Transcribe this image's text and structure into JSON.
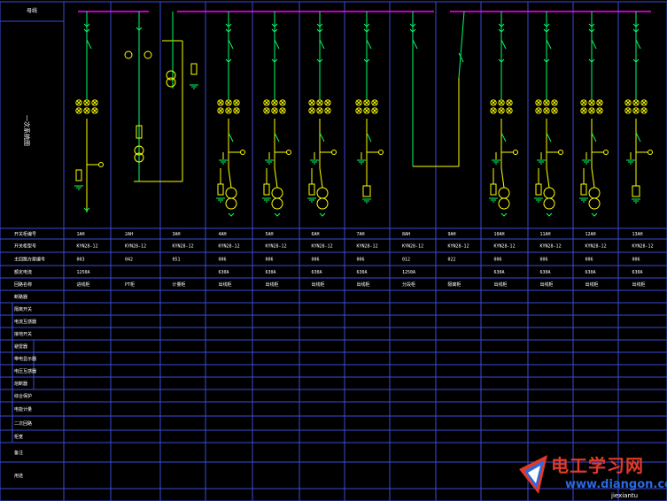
{
  "colors": {
    "background": "#000000",
    "grid": "#3a4bd8",
    "bus": "#ff00ff",
    "breaker": "#ffff00",
    "device_green": "#00ff66",
    "text": "#ffffff",
    "watermark_red": "#e03a2a",
    "watermark_blue": "#2a6ae0"
  },
  "header": {
    "top_left_label": "母线"
  },
  "left_titles": {
    "diagram_label": "一次系统图"
  },
  "row_labels": [
    "开关柜编号",
    "开关柜型号",
    "主回路方案编号",
    "额定电流",
    "回路名称",
    "断路器",
    "隔离开关",
    "电流互感器",
    "接地开关",
    "避雷器",
    "带电显示器",
    "电压互感器",
    "熔断器",
    "综合保护",
    "电能计量",
    "二次回路",
    "柜宽",
    "备注",
    "用途"
  ],
  "columns": [
    {
      "no": "1AH",
      "model": "KYN28-12",
      "scheme": "003",
      "current": "1250A",
      "name": "进线柜"
    },
    {
      "no": "2AH",
      "model": "KYN28-12",
      "scheme": "042",
      "current": "",
      "name": "PT柜"
    },
    {
      "no": "3AH",
      "model": "KYN28-12",
      "scheme": "051",
      "current": "",
      "name": "计量柜"
    },
    {
      "no": "4AH",
      "model": "KYN28-12",
      "scheme": "006",
      "current": "630A",
      "name": "出线柜"
    },
    {
      "no": "5AH",
      "model": "KYN28-12",
      "scheme": "006",
      "current": "630A",
      "name": "出线柜"
    },
    {
      "no": "6AH",
      "model": "KYN28-12",
      "scheme": "006",
      "current": "630A",
      "name": "出线柜"
    },
    {
      "no": "7AH",
      "model": "KYN28-12",
      "scheme": "006",
      "current": "630A",
      "name": "出线柜"
    },
    {
      "no": "8AH",
      "model": "KYN28-12",
      "scheme": "012",
      "current": "1250A",
      "name": "分段柜"
    },
    {
      "no": "9AH",
      "model": "KYN28-12",
      "scheme": "022",
      "current": "",
      "name": "隔离柜"
    },
    {
      "no": "10AH",
      "model": "KYN28-12",
      "scheme": "006",
      "current": "630A",
      "name": "出线柜"
    },
    {
      "no": "11AH",
      "model": "KYN28-12",
      "scheme": "006",
      "current": "630A",
      "name": "出线柜"
    },
    {
      "no": "12AH",
      "model": "KYN28-12",
      "scheme": "006",
      "current": "630A",
      "name": "出线柜"
    },
    {
      "no": "13AH",
      "model": "KYN28-12",
      "scheme": "006",
      "current": "630A",
      "name": "出线柜"
    }
  ],
  "watermark": {
    "title": "电工学习网",
    "url": "www.diangon.com",
    "small": "jiexiantu"
  }
}
